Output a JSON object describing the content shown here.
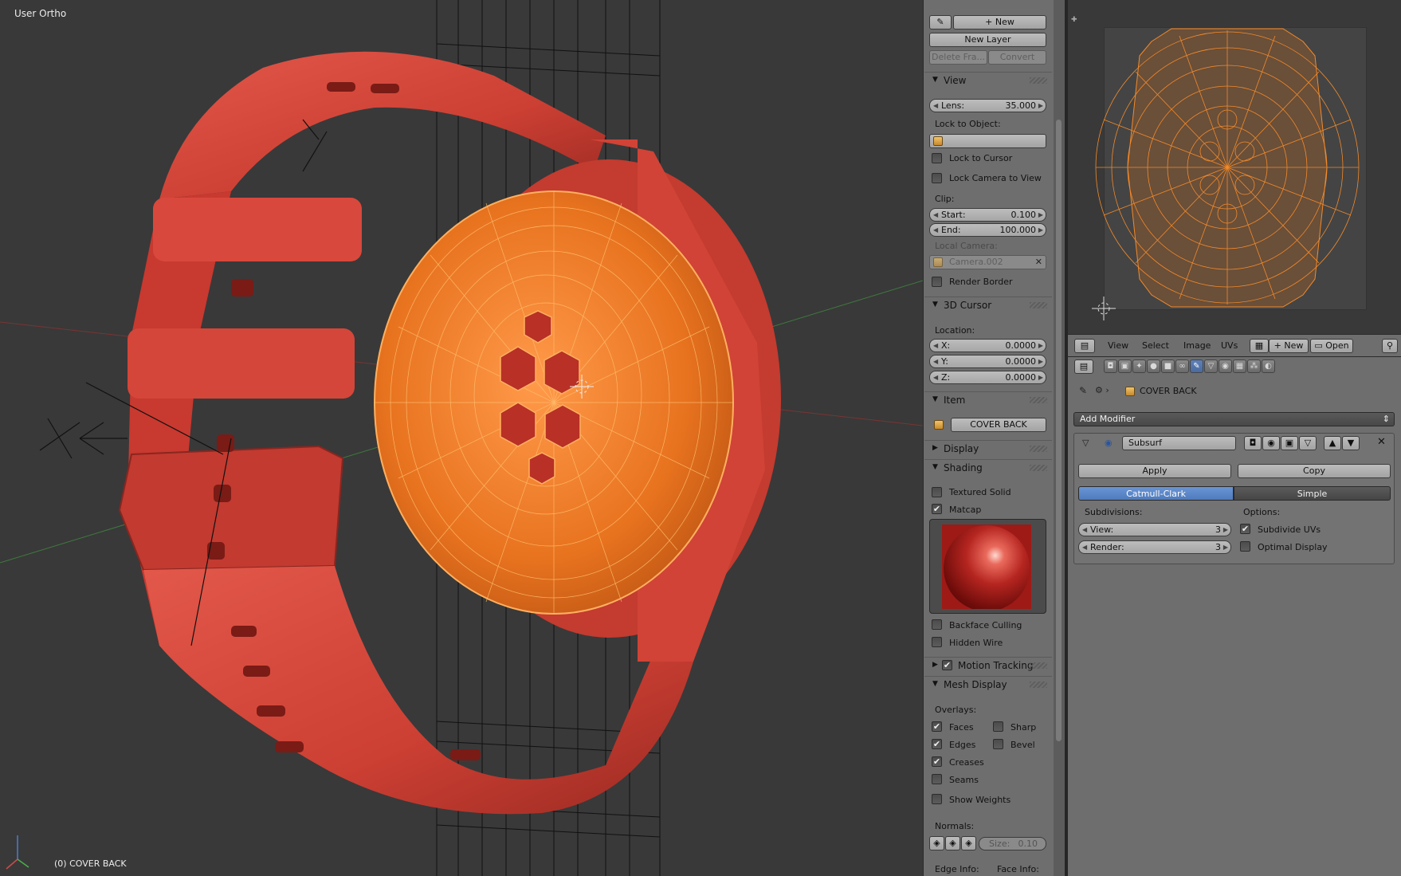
{
  "viewport": {
    "title": "User Ortho",
    "active_object": "(0) COVER BACK"
  },
  "grease_pencil": {
    "new_label": "New",
    "new_layer_label": "New Layer",
    "delete_frame_label": "Delete Fra...",
    "convert_label": "Convert"
  },
  "view_panel": {
    "header": "View",
    "lens_label": "Lens:",
    "lens_value": "35.000",
    "lock_to_object_label": "Lock to Object:",
    "lock_to_cursor_label": "Lock to Cursor",
    "lock_to_cursor_checked": false,
    "lock_camera_label": "Lock Camera to View",
    "lock_camera_checked": false,
    "clip_label": "Clip:",
    "clip_start_label": "Start:",
    "clip_start_value": "0.100",
    "clip_end_label": "End:",
    "clip_end_value": "100.000",
    "local_camera_label": "Local Camera:",
    "local_camera_value": "Camera.002",
    "render_border_label": "Render Border",
    "render_border_checked": false
  },
  "cursor_panel": {
    "header": "3D Cursor",
    "location_label": "Location:",
    "x_label": "X:",
    "x_value": "0.0000",
    "y_label": "Y:",
    "y_value": "0.0000",
    "z_label": "Z:",
    "z_value": "0.0000"
  },
  "item_panel": {
    "header": "Item",
    "name": "COVER BACK"
  },
  "display_panel": {
    "header": "Display"
  },
  "shading_panel": {
    "header": "Shading",
    "textured_solid_label": "Textured Solid",
    "textured_solid_checked": false,
    "matcap_label": "Matcap",
    "matcap_checked": true,
    "backface_label": "Backface Culling",
    "backface_checked": false,
    "hidden_wire_label": "Hidden Wire",
    "hidden_wire_checked": false
  },
  "motion_tracking_panel": {
    "header": "Motion Tracking",
    "checked": true
  },
  "mesh_display_panel": {
    "header": "Mesh Display",
    "overlays_label": "Overlays:",
    "faces_label": "Faces",
    "faces_checked": true,
    "sharp_label": "Sharp",
    "sharp_checked": false,
    "edges_label": "Edges",
    "edges_checked": true,
    "bevel_label": "Bevel",
    "bevel_checked": false,
    "creases_label": "Creases",
    "creases_checked": true,
    "seams_label": "Seams",
    "seams_checked": false,
    "show_weights_label": "Show Weights",
    "show_weights_checked": false,
    "normals_label": "Normals:",
    "size_label": "Size:",
    "size_value": "0.10",
    "edge_info_label": "Edge Info:",
    "face_info_label": "Face Info:"
  },
  "uv_editor": {
    "menus": [
      "View",
      "Select",
      "Image",
      "UVs"
    ],
    "new_label": "New",
    "open_label": "Open"
  },
  "properties": {
    "object_name": "COVER BACK",
    "add_modifier_label": "Add Modifier",
    "modifier": {
      "name": "Subsurf",
      "apply_label": "Apply",
      "copy_label": "Copy",
      "mode_catmull": "Catmull-Clark",
      "mode_simple": "Simple",
      "active_mode": "Catmull-Clark",
      "subdivisions_label": "Subdivisions:",
      "view_label": "View:",
      "view_value": "3",
      "render_label": "Render:",
      "render_value": "3",
      "options_label": "Options:",
      "subdivide_uvs_label": "Subdivide UVs",
      "subdivide_uvs_checked": true,
      "optimal_display_label": "Optimal Display",
      "optimal_display_checked": false
    }
  },
  "colors": {
    "viewport_bg": "#393939",
    "panel_bg": "#6e6e6e",
    "accent_blue": "#5a86c8",
    "selection_orange": "#f28a2a",
    "strap_red": "#d0453a"
  }
}
